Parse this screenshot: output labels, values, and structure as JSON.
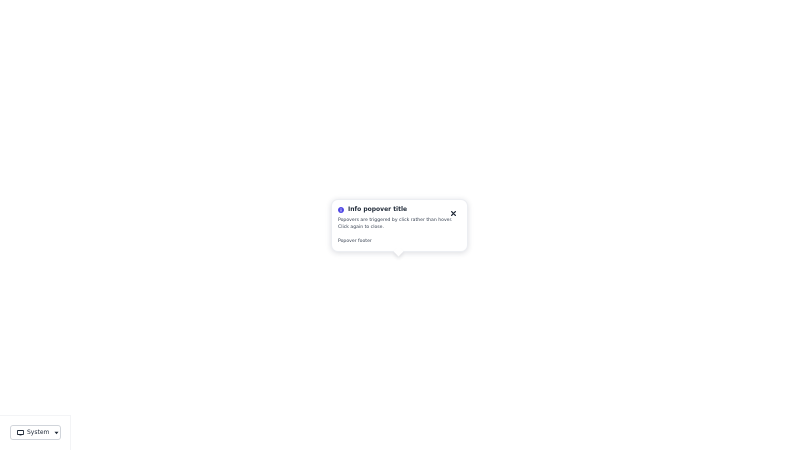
{
  "popover": {
    "title": "Info popover title",
    "body": "Popovers are triggered by click rather than hover. Click again to close.",
    "footer": "Popover footer",
    "icon": "info-icon",
    "close_icon": "close-icon",
    "accent_color": "#4f46e5"
  },
  "theme_switcher": {
    "selected": "System",
    "icon": "monitor-icon",
    "caret_icon": "caret-down-icon"
  }
}
